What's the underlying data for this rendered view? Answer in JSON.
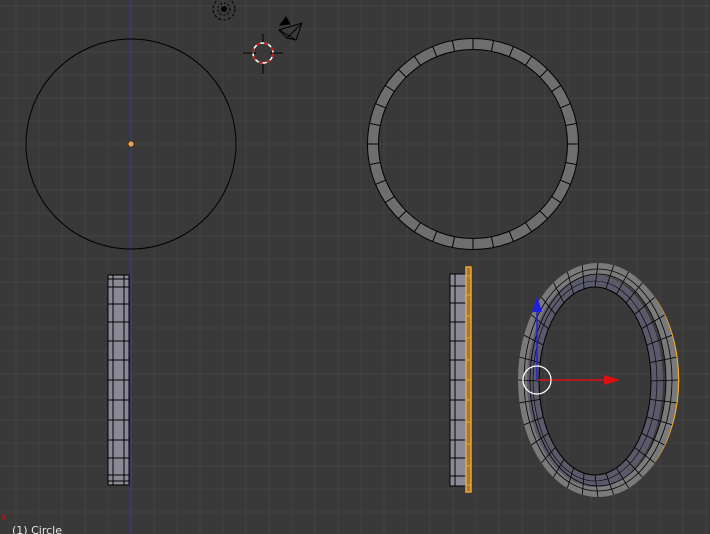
{
  "viewport": {
    "object_info": "(1) Circle",
    "colors": {
      "background": "#393939",
      "grid": "#424242",
      "selected": "#f5a623",
      "mesh_face": "#8a8a96",
      "ring_face": "#6e6e6e",
      "axis_x": "#e01010",
      "axis_z": "#2020e0",
      "wire": "#000000"
    },
    "icons": [
      "lamp-icon",
      "camera-icon",
      "3d-cursor-icon",
      "origin-icon",
      "manipulator-icon",
      "axis-x-marker-icon"
    ]
  }
}
